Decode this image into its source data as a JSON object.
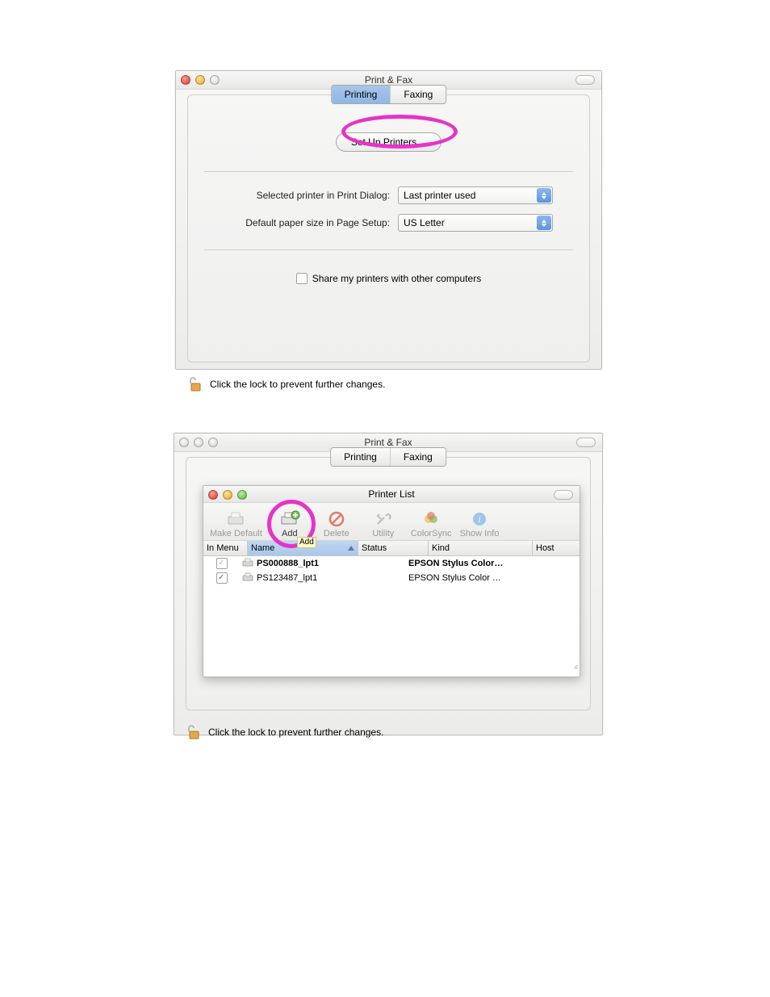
{
  "window1": {
    "title": "Print & Fax",
    "tabs": {
      "printing": "Printing",
      "faxing": "Faxing"
    },
    "setup_button": "Set Up Printers…",
    "labels": {
      "selected_printer": "Selected printer in Print Dialog:",
      "default_paper": "Default paper size in Page Setup:"
    },
    "popups": {
      "selected_printer_value": "Last printer used",
      "default_paper_value": "US Letter"
    },
    "share_label": "Share my printers with other computers",
    "lock_text": "Click the lock to prevent further changes."
  },
  "window2": {
    "title": "Print & Fax",
    "tabs": {
      "printing": "Printing",
      "faxing": "Faxing"
    },
    "lock_text": "Click the lock to prevent further changes.",
    "sub": {
      "title": "Printer List",
      "toolbar": {
        "make_default": "Make Default",
        "add": "Add",
        "delete": "Delete",
        "utility": "Utility",
        "colorsync": "ColorSync",
        "show_info": "Show Info"
      },
      "add_tooltip": "Add",
      "columns": {
        "in_menu": "In Menu",
        "name": "Name",
        "status": "Status",
        "kind": "Kind",
        "host": "Host"
      },
      "rows": [
        {
          "in_menu": true,
          "in_menu_dim": true,
          "name": "PS000888_lpt1",
          "bold": true,
          "status": "",
          "kind": "EPSON Stylus Color…",
          "host": ""
        },
        {
          "in_menu": true,
          "in_menu_dim": false,
          "name": "PS123487_lpt1",
          "bold": false,
          "status": "",
          "kind": "EPSON Stylus Color …",
          "host": ""
        }
      ]
    }
  }
}
